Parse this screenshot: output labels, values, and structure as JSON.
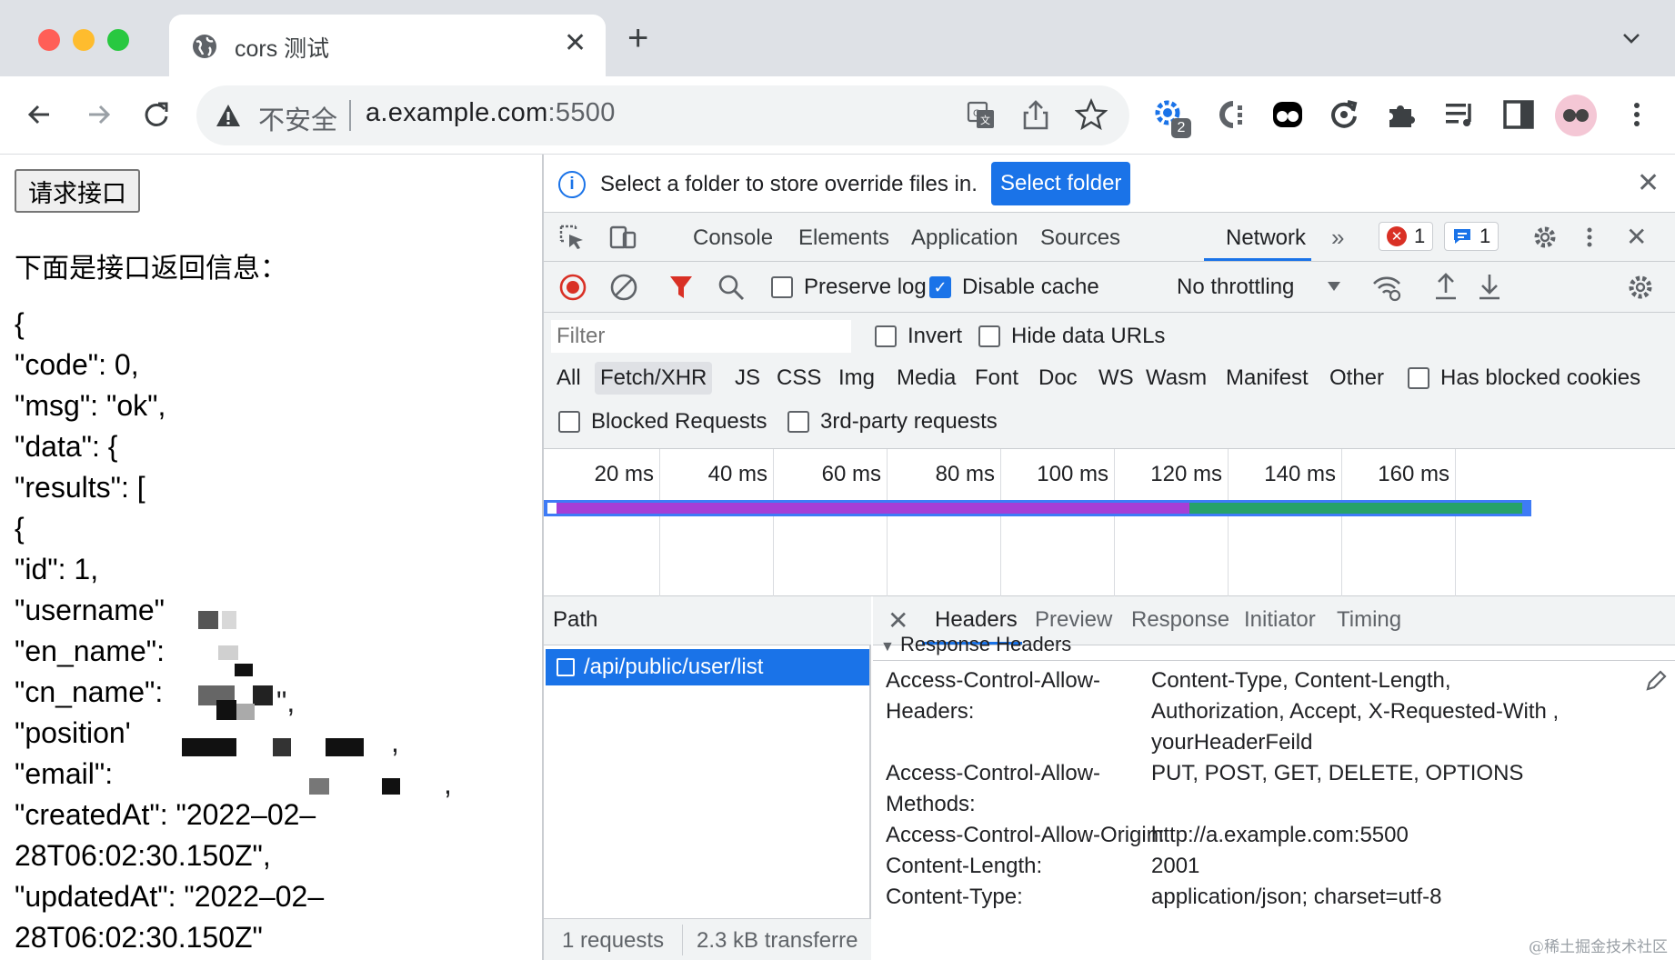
{
  "browser": {
    "tab_title": "cors 测试",
    "omnibox": {
      "security_label": "不安全",
      "url_host": "a.example.com",
      "url_port": ":5500"
    },
    "extension_badge": "2",
    "icons": [
      "globe-icon",
      "close-icon",
      "new-tab-icon",
      "chevron-down-icon",
      "back-icon",
      "forward-icon",
      "reload-icon",
      "warning-icon",
      "translate-icon",
      "share-icon",
      "star-icon",
      "extension-gear-icon",
      "extension-c-icon",
      "extension-ghost-icon",
      "extension-sync-icon",
      "puzzle-icon",
      "reading-list-icon",
      "side-panel-icon",
      "avatar",
      "more-menu-icon"
    ]
  },
  "page": {
    "request_button": "请求接口",
    "heading": "下面是接口返回信息：",
    "json_lines": [
      "{",
      "\"code\": 0,",
      "\"msg\": \"ok\",",
      "\"data\": {",
      "\"results\": [",
      "{",
      "\"id\": 1,",
      "\"username\"",
      "\"en_name\":",
      "\"cn_name\":",
      "\"position'",
      "\"email\":",
      "\"createdAt\": \"2022–02–",
      "28T06:02:30.150Z\",",
      "\"updatedAt\": \"2022–02–",
      "28T06:02:30.150Z\""
    ],
    "redacted_suffixes": {
      "cn_name": "\",",
      "position": ",",
      "email": ","
    }
  },
  "devtools": {
    "infobar": {
      "message": "Select a folder to store override files in.",
      "button": "Select folder"
    },
    "tabs": [
      "Console",
      "Elements",
      "Application",
      "Sources",
      "Network"
    ],
    "active_tab": "Network",
    "error_count": "1",
    "message_count": "1",
    "controls": {
      "preserve_log": "Preserve log",
      "preserve_log_checked": false,
      "disable_cache": "Disable cache",
      "disable_cache_checked": true,
      "throttling": "No throttling"
    },
    "filter": {
      "placeholder": "Filter",
      "invert": "Invert",
      "hide_data_urls": "Hide data URLs",
      "types": [
        "All",
        "Fetch/XHR",
        "JS",
        "CSS",
        "Img",
        "Media",
        "Font",
        "Doc",
        "WS",
        "Wasm",
        "Manifest",
        "Other"
      ],
      "active_type": "Fetch/XHR",
      "has_blocked_cookies": "Has blocked cookies",
      "blocked_requests": "Blocked Requests",
      "third_party": "3rd-party requests"
    },
    "timeline_ticks": [
      "20 ms",
      "40 ms",
      "60 ms",
      "80 ms",
      "100 ms",
      "120 ms",
      "140 ms",
      "160 ms"
    ],
    "timeline_colors": {
      "overall": "#3e7bf6",
      "waiting": "#a53ed6",
      "download": "#26a269"
    },
    "path_header": "Path",
    "request": "/api/public/user/list",
    "status": {
      "requests": "1 requests",
      "transferred": "2.3 kB transferre"
    },
    "detail_tabs": [
      "Headers",
      "Preview",
      "Response",
      "Initiator",
      "Timing"
    ],
    "active_detail_tab": "Headers",
    "section_title": "Response Headers",
    "headers": [
      {
        "name": "Access-Control-Allow-",
        "value": "Content-Type, Content-Length,"
      },
      {
        "name": "Headers:",
        "value": "Authorization, Accept, X-Requested-With ,"
      },
      {
        "name": "",
        "value": "yourHeaderFeild"
      },
      {
        "name": "Access-Control-Allow-",
        "value": "PUT, POST, GET, DELETE, OPTIONS"
      },
      {
        "name": "Methods:",
        "value": ""
      },
      {
        "name": "Access-Control-Allow-Origin:",
        "value": "http://a.example.com:5500"
      },
      {
        "name": "Content-Length:",
        "value": "2001"
      },
      {
        "name": "Content-Type:",
        "value": "application/json; charset=utf-8"
      }
    ]
  },
  "watermark": "@稀土掘金技术社区"
}
